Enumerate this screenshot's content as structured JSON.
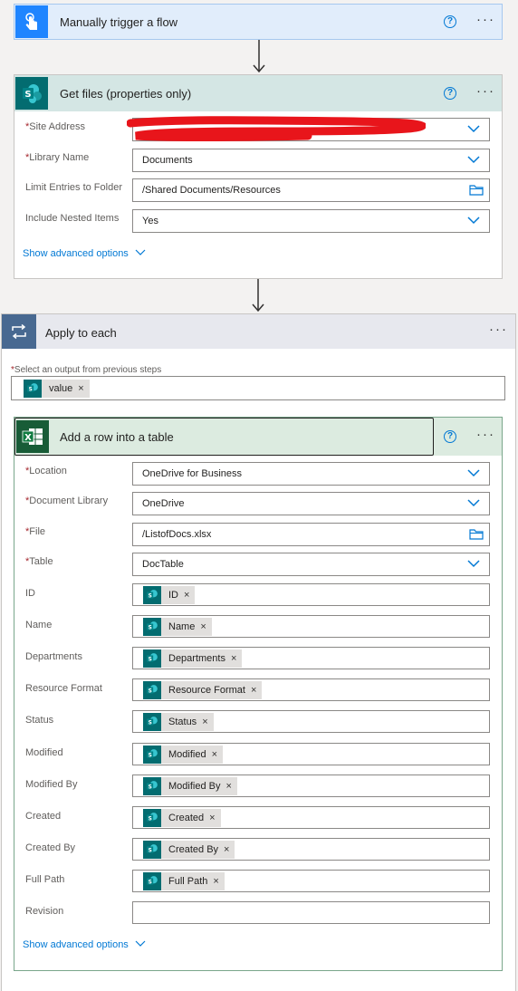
{
  "trigger": {
    "title": "Manually trigger a flow"
  },
  "getFiles": {
    "title": "Get files (properties only)",
    "fields": [
      {
        "label": "Site Address",
        "required": true,
        "value": "",
        "control": "dropdown"
      },
      {
        "label": "Library Name",
        "required": true,
        "value": "Documents",
        "control": "dropdown"
      },
      {
        "label": "Limit Entries to Folder",
        "required": false,
        "value": "/Shared Documents/Resources",
        "control": "folder"
      },
      {
        "label": "Include Nested Items",
        "required": false,
        "value": "Yes",
        "control": "dropdown"
      }
    ],
    "advanced": "Show advanced options"
  },
  "applyToEach": {
    "title": "Apply to each",
    "selectLabel": "Select an output from previous steps",
    "token": "value"
  },
  "addRow": {
    "title": "Add a row into a table",
    "fields": [
      {
        "label": "Location",
        "required": true,
        "value": "OneDrive for Business",
        "control": "dropdown"
      },
      {
        "label": "Document Library",
        "required": true,
        "value": "OneDrive",
        "control": "dropdown"
      },
      {
        "label": "File",
        "required": true,
        "value": "/ListofDocs.xlsx",
        "control": "folder"
      },
      {
        "label": "Table",
        "required": true,
        "value": "DocTable",
        "control": "dropdown"
      }
    ],
    "tokenFields": [
      {
        "label": "ID",
        "token": "ID"
      },
      {
        "label": "Name",
        "token": "Name"
      },
      {
        "label": "Departments",
        "token": "Departments"
      },
      {
        "label": "Resource Format",
        "token": "Resource Format"
      },
      {
        "label": "Status",
        "token": "Status"
      },
      {
        "label": "Modified",
        "token": "Modified"
      },
      {
        "label": "Modified By",
        "token": "Modified By"
      },
      {
        "label": "Created",
        "token": "Created"
      },
      {
        "label": "Created By",
        "token": "Created By"
      },
      {
        "label": "Full Path",
        "token": "Full Path"
      },
      {
        "label": "Revision",
        "token": ""
      }
    ],
    "advanced": "Show advanced options"
  },
  "colors": {
    "accent": "#0078d4",
    "sharepoint": "#036c70",
    "excel": "#185c37",
    "required": "#a4262c",
    "redaction": "#e8151b"
  }
}
